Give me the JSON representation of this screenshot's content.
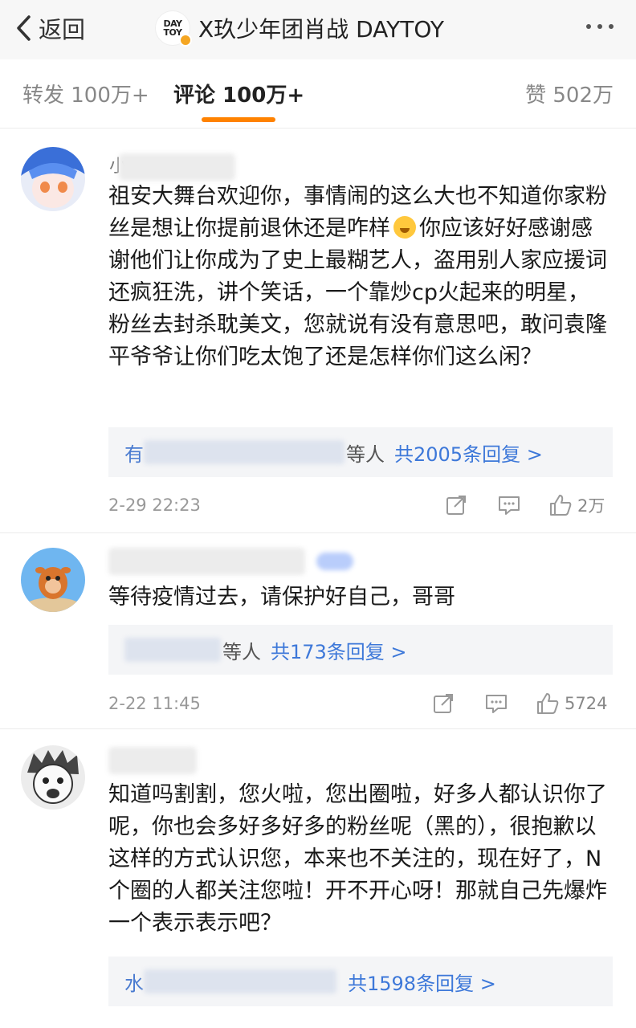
{
  "header": {
    "back_label": "返回",
    "logo_text_top": "DAY",
    "logo_text_bottom": "TOY",
    "title": "X玖少年团肖战 DAYTOY"
  },
  "tabs": [
    {
      "label": "转发 100万+"
    },
    {
      "label": "评论 100万+",
      "active": true
    },
    {
      "label": "赞 502万"
    }
  ],
  "accent_color": "#ff8200",
  "link_color": "#3d78d9",
  "comments": [
    {
      "username_visible": "小",
      "text_before_emoji": "祖安大舞台欢迎你，事情闹的这么大也不知道你家粉丝是想让你提前退休还是咋样",
      "emoji": "hugging-face",
      "text_after_emoji": "你应该好好感谢感谢他们让你成为了史上最糊艺人，盗用别人家应援词还疯狂洗，讲个笑话，一个靠炒cp火起来的明星，粉丝去封杀耽美文，您就说有没有意思吧，敢问袁隆平爷爷让你们吃太饱了还是怎样你们这么闲？",
      "reply_first_char": "有",
      "reply_suffix": "等人",
      "reply_count": "共2005条回复 >",
      "time": "2-29 22:23",
      "likes": "2万"
    },
    {
      "text": "等待疫情过去，请保护好自己，哥哥",
      "reply_suffix": "等人",
      "reply_count": "共173条回复 >",
      "time": "2-22 11:45",
      "likes": "5724"
    },
    {
      "text": "知道吗割割，您火啦，您出圈啦，好多人都认识你了呢，你也会多好多好多的粉丝呢（黑的），很抱歉以这样的方式认识您，本来也不关注的，现在好了，N个圈的人都关注您啦！开不开心呀！那就自己先爆炸一个表示表示吧？",
      "reply_first_char": "水",
      "reply_count": "共1598条回复 >"
    }
  ]
}
